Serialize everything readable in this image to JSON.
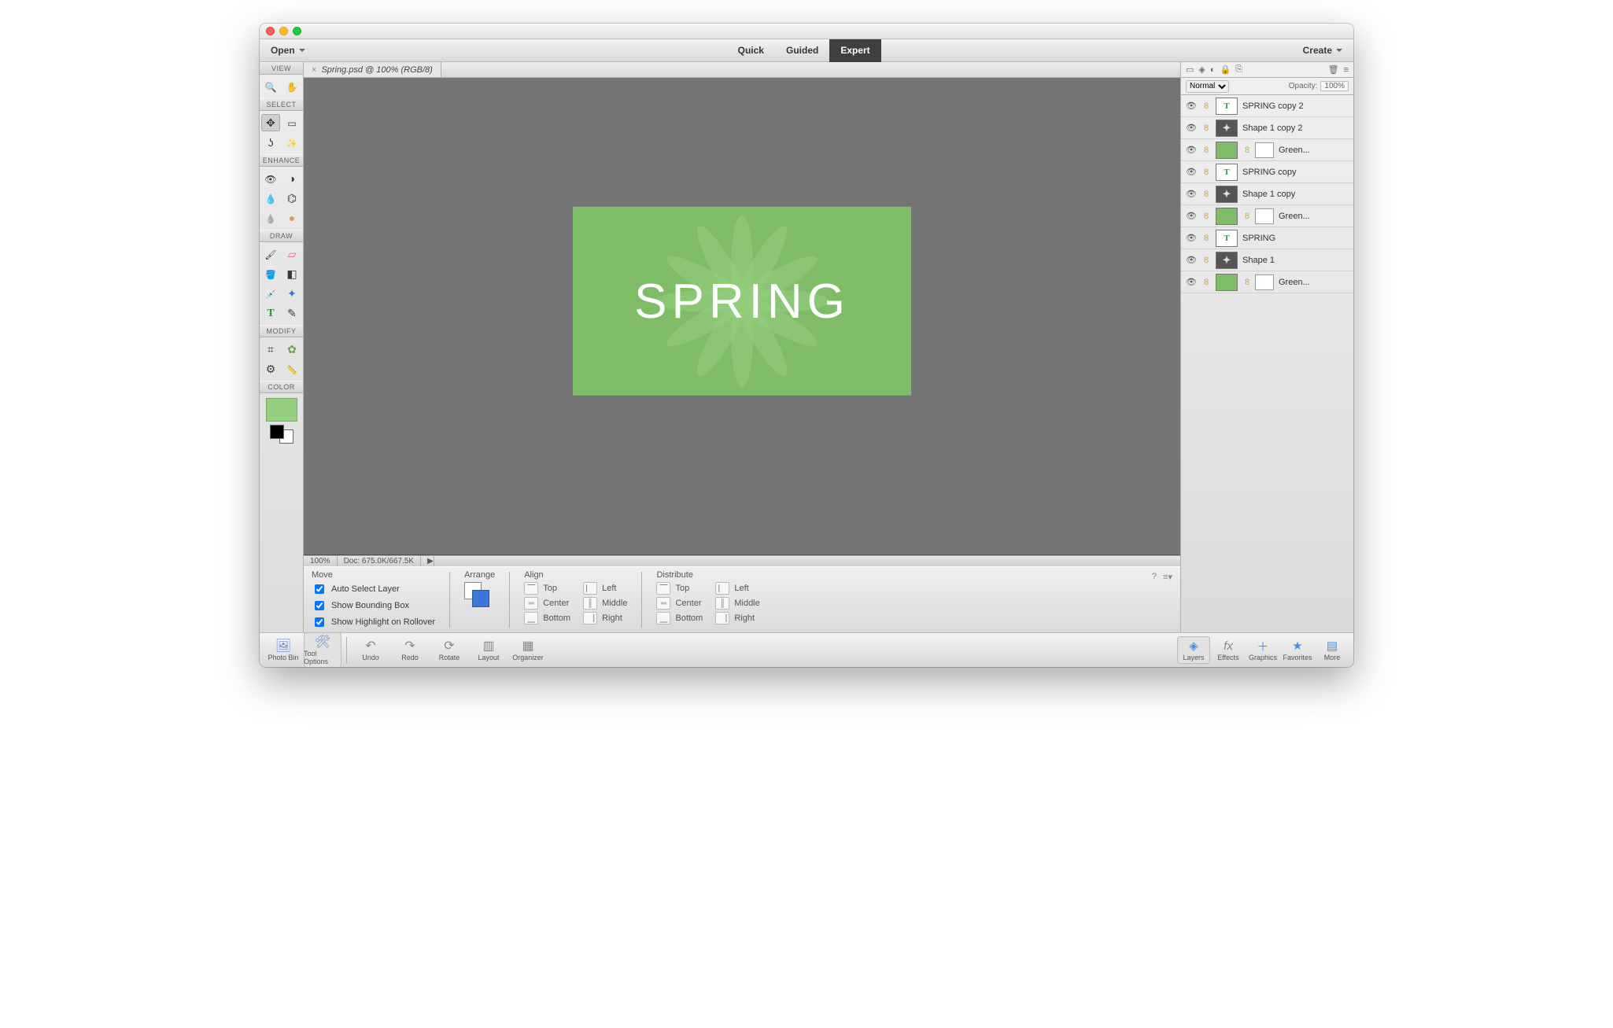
{
  "titlebar": {},
  "modebar": {
    "open": "Open",
    "quick": "Quick",
    "guided": "Guided",
    "expert": "Expert",
    "create": "Create"
  },
  "docTab": {
    "label": "Spring.psd @ 100% (RGB/8)"
  },
  "toolGroups": {
    "view": "VIEW",
    "select": "SELECT",
    "enhance": "ENHANCE",
    "draw": "DRAW",
    "modify": "MODIFY",
    "color": "COLOR"
  },
  "canvasText": "SPRING",
  "statusbar": {
    "zoom": "100%",
    "doc": "Doc: 675.0K/667.5K"
  },
  "options": {
    "moveTitle": "Move",
    "autoSelect": "Auto Select Layer",
    "boundingBox": "Show Bounding Box",
    "rollover": "Show Highlight on Rollover",
    "arrangeTitle": "Arrange",
    "alignTitle": "Align",
    "align": {
      "top": "Top",
      "center": "Center",
      "bottom": "Bottom",
      "left": "Left",
      "middle": "Middle",
      "right": "Right"
    },
    "distTitle": "Distribute",
    "dist": {
      "top": "Top",
      "center": "Center",
      "bottom": "Bottom",
      "left": "Left",
      "middle": "Middle",
      "right": "Right"
    }
  },
  "layersPanel": {
    "blend": "Normal",
    "opacityLabel": "Opacity:",
    "opacityValue": "100%"
  },
  "layers": [
    {
      "type": "text",
      "name": "SPRING copy 2",
      "mask": false
    },
    {
      "type": "shape",
      "name": "Shape 1 copy 2",
      "mask": false
    },
    {
      "type": "green",
      "name": "Green...",
      "mask": true
    },
    {
      "type": "text",
      "name": "SPRING copy",
      "mask": false
    },
    {
      "type": "shape",
      "name": "Shape 1 copy",
      "mask": false
    },
    {
      "type": "green",
      "name": "Green...",
      "mask": true
    },
    {
      "type": "text",
      "name": "SPRING",
      "mask": false
    },
    {
      "type": "shape",
      "name": "Shape 1",
      "mask": false
    },
    {
      "type": "green",
      "name": "Green...",
      "mask": true
    }
  ],
  "taskbar": {
    "photoBin": "Photo Bin",
    "toolOptions": "Tool Options",
    "undo": "Undo",
    "redo": "Redo",
    "rotate": "Rotate",
    "layout": "Layout",
    "organizer": "Organizer",
    "layers": "Layers",
    "effects": "Effects",
    "graphics": "Graphics",
    "favorites": "Favorites",
    "more": "More"
  }
}
